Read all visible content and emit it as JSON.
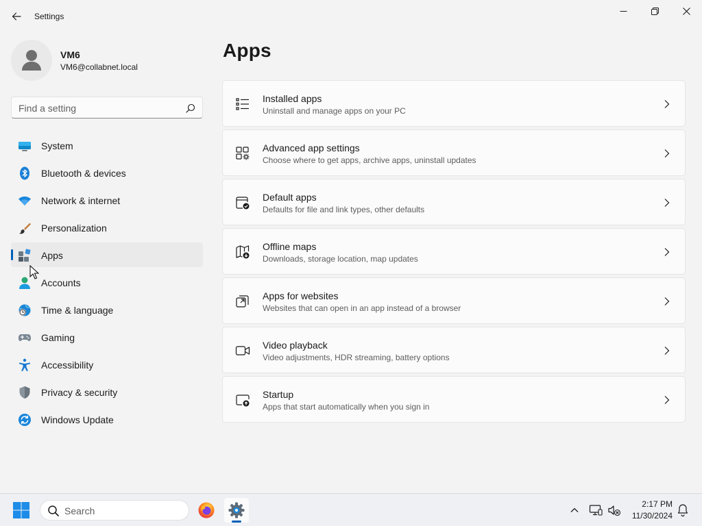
{
  "window": {
    "title": "Settings",
    "back_icon": "back-arrow-icon",
    "controls": [
      "minimize-icon",
      "maximize-icon",
      "close-icon"
    ]
  },
  "profile": {
    "name": "VM6",
    "email": "VM6@collabnet.local",
    "avatar_icon": "person-icon"
  },
  "search": {
    "placeholder": "Find a setting",
    "icon": "search-icon"
  },
  "nav": {
    "selected": "Apps",
    "accent": "#005fb8",
    "items": [
      {
        "label": "System",
        "icon": "monitor-icon"
      },
      {
        "label": "Bluetooth & devices",
        "icon": "bluetooth-icon"
      },
      {
        "label": "Network & internet",
        "icon": "wifi-icon"
      },
      {
        "label": "Personalization",
        "icon": "paintbrush-icon"
      },
      {
        "label": "Apps",
        "icon": "apps-icon"
      },
      {
        "label": "Accounts",
        "icon": "account-icon"
      },
      {
        "label": "Time & language",
        "icon": "globe-clock-icon"
      },
      {
        "label": "Gaming",
        "icon": "gamepad-icon"
      },
      {
        "label": "Accessibility",
        "icon": "accessibility-icon"
      },
      {
        "label": "Privacy & security",
        "icon": "shield-icon"
      },
      {
        "label": "Windows Update",
        "icon": "update-icon"
      }
    ]
  },
  "main": {
    "title": "Apps",
    "cards": [
      {
        "title": "Installed apps",
        "desc": "Uninstall and manage apps on your PC",
        "icon": "list-icon"
      },
      {
        "title": "Advanced app settings",
        "desc": "Choose where to get apps, archive apps, uninstall updates",
        "icon": "app-settings-icon"
      },
      {
        "title": "Default apps",
        "desc": "Defaults for file and link types, other defaults",
        "icon": "default-apps-icon"
      },
      {
        "title": "Offline maps",
        "desc": "Downloads, storage location, map updates",
        "icon": "map-icon"
      },
      {
        "title": "Apps for websites",
        "desc": "Websites that can open in an app instead of a browser",
        "icon": "open-external-icon"
      },
      {
        "title": "Video playback",
        "desc": "Video adjustments, HDR streaming, battery options",
        "icon": "video-icon"
      },
      {
        "title": "Startup",
        "desc": "Apps that start automatically when you sign in",
        "icon": "startup-icon"
      }
    ]
  },
  "taskbar": {
    "search_label": "Search",
    "pinned": [
      "firefox-icon",
      "settings-gear-icon"
    ],
    "tray": [
      "chevron-up-icon",
      "network-icon",
      "volume-muted-icon",
      "notification-bell-icon"
    ],
    "time": "2:17 PM",
    "date": "11/30/2024"
  }
}
